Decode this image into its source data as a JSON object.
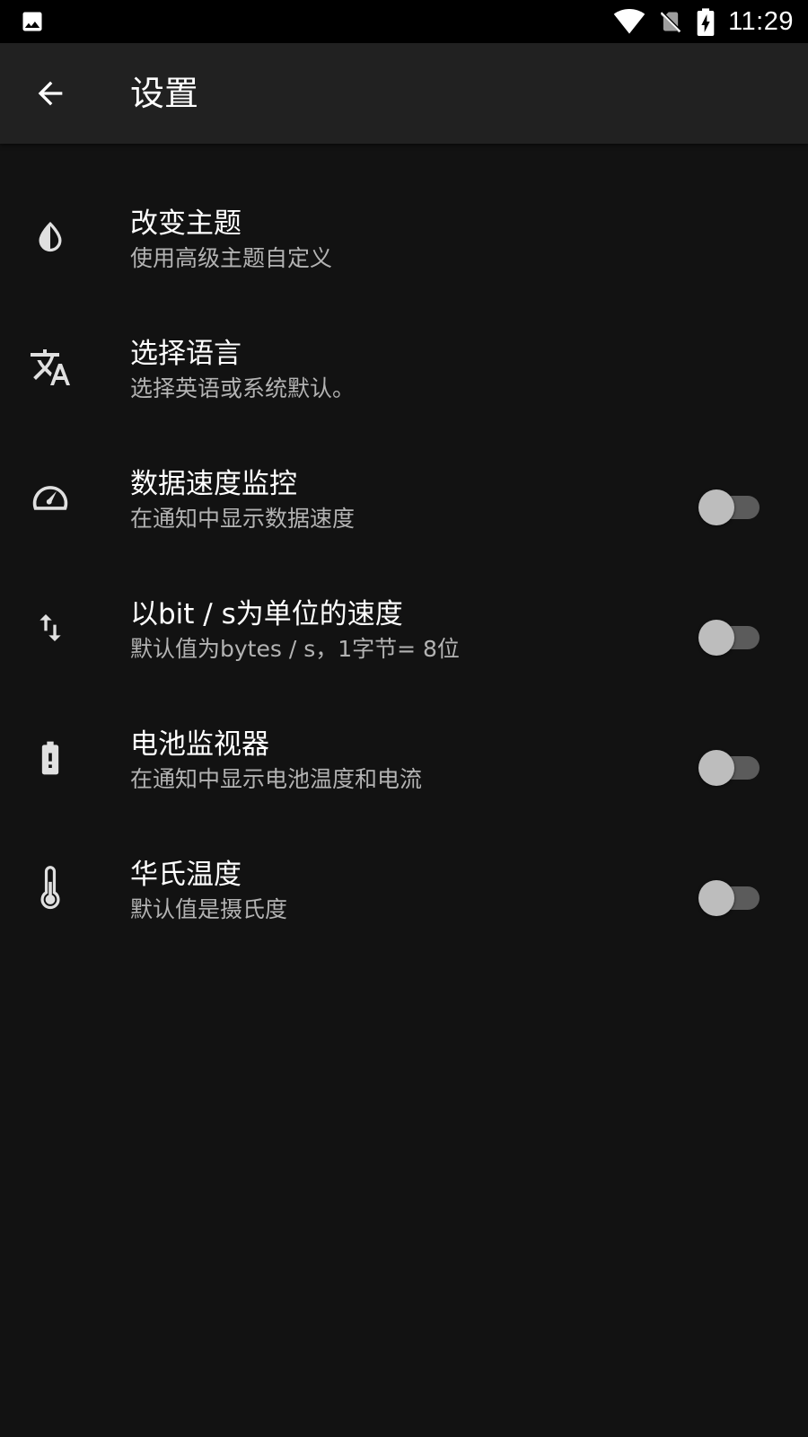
{
  "status_bar": {
    "time": "11:29",
    "icons": [
      "image-icon",
      "wifi-icon",
      "no-sim-icon",
      "battery-charging-icon"
    ]
  },
  "app_bar": {
    "title": "设置",
    "back_icon": "arrow-back-icon"
  },
  "settings": [
    {
      "title": "改变主题",
      "subtitle": "使用高级主题自定义",
      "icon": "theme-drop-icon",
      "has_switch": false
    },
    {
      "title": "选择语言",
      "subtitle": "选择英语或系统默认。",
      "icon": "translate-icon",
      "has_switch": false
    },
    {
      "title": "数据速度监控",
      "subtitle": "在通知中显示数据速度",
      "icon": "speedometer-icon",
      "has_switch": true,
      "on": false
    },
    {
      "title": "以bit / s为单位的速度",
      "subtitle": "默认值为bytes / s，1字节= 8位",
      "icon": "swap-vertical-icon",
      "has_switch": true,
      "on": false
    },
    {
      "title": "电池监视器",
      "subtitle": "在通知中显示电池温度和电流",
      "icon": "battery-alert-icon",
      "has_switch": true,
      "on": false
    },
    {
      "title": "华氏温度",
      "subtitle": "默认值是摄氏度",
      "icon": "thermometer-icon",
      "has_switch": true,
      "on": false
    }
  ],
  "colors": {
    "background": "#121212",
    "app_bar": "#212121",
    "status_bar": "#000000",
    "subtitle_text": "#b3b3b3",
    "switch_thumb": "#bdbdbd",
    "switch_track": "#5b5b5b"
  }
}
